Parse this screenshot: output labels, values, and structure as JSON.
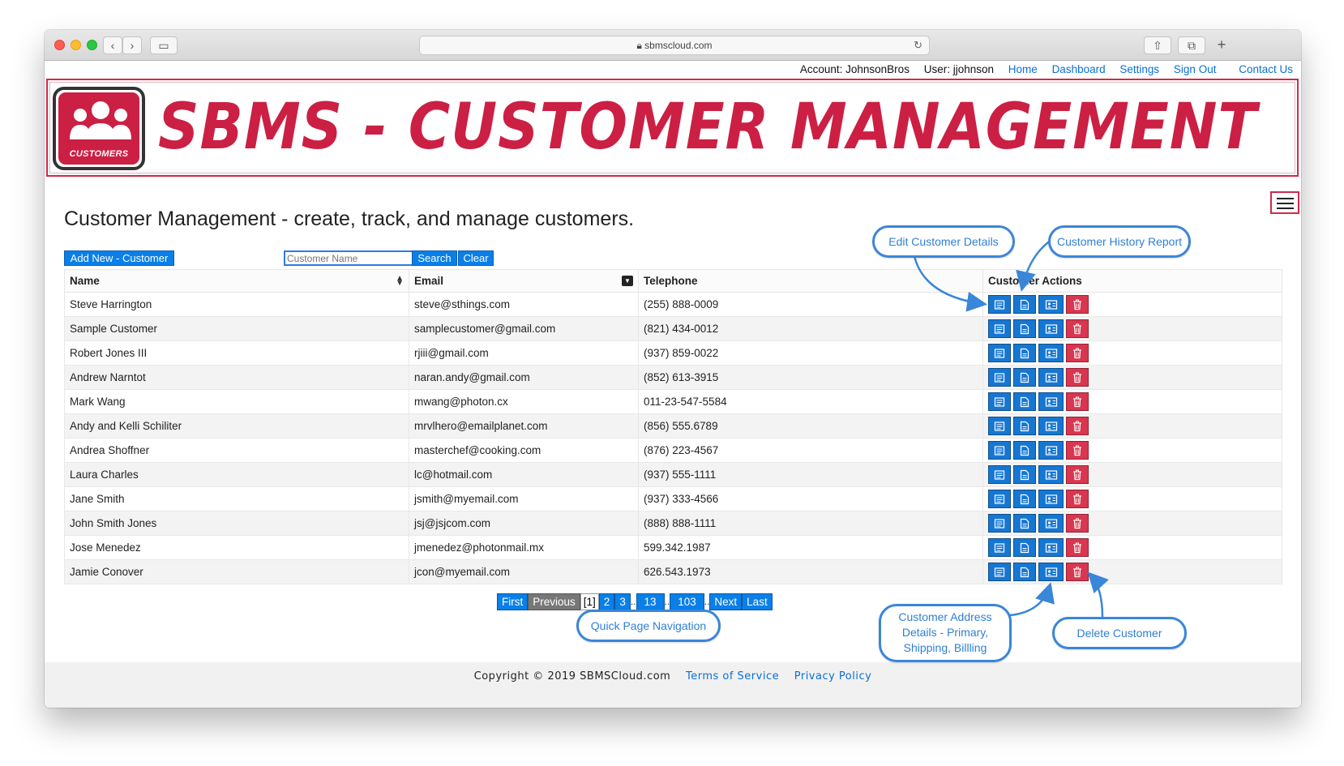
{
  "browser": {
    "url": "sbmscloud.com"
  },
  "topnav": {
    "account": "Account: JohnsonBros",
    "user": "User: jjohnson",
    "links": [
      "Home",
      "Dashboard",
      "Settings",
      "Sign Out",
      "Contact Us"
    ]
  },
  "banner": {
    "logo_text": "CUSTOMERS",
    "title": "SBMS - CUSTOMER MANAGEMENT"
  },
  "heading": "Customer Management - create, track, and manage customers.",
  "toolbar": {
    "add_label": "Add New - Customer",
    "search_placeholder": "Customer Name",
    "search_label": "Search",
    "clear_label": "Clear"
  },
  "table": {
    "headers": [
      "Name",
      "Email",
      "Telephone",
      "Customer Actions"
    ],
    "rows": [
      {
        "name": "Steve Harrington",
        "email": "steve@sthings.com",
        "phone": "(255) 888-0009"
      },
      {
        "name": "Sample Customer",
        "email": "samplecustomer@gmail.com",
        "phone": "(821) 434-0012"
      },
      {
        "name": "Robert Jones III",
        "email": "rjiii@gmail.com",
        "phone": "(937) 859-0022"
      },
      {
        "name": "Andrew Narntot",
        "email": "naran.andy@gmail.com",
        "phone": "(852) 613-3915"
      },
      {
        "name": "Mark Wang",
        "email": "mwang@photon.cx",
        "phone": "011-23-547-5584"
      },
      {
        "name": "Andy and Kelli Schiliter",
        "email": "mrvlhero@emailplanet.com",
        "phone": "(856) 555.6789"
      },
      {
        "name": "Andrea Shoffner",
        "email": "masterchef@cooking.com",
        "phone": "(876) 223-4567"
      },
      {
        "name": "Laura Charles",
        "email": "lc@hotmail.com",
        "phone": "(937) 555-1111"
      },
      {
        "name": "Jane Smith",
        "email": "jsmith@myemail.com",
        "phone": "(937) 333-4566"
      },
      {
        "name": "John Smith Jones",
        "email": "jsj@jsjcom.com",
        "phone": "(888) 888-1111"
      },
      {
        "name": "Jose Menedez",
        "email": "jmenedez@photonmail.mx",
        "phone": "599.342.1987"
      },
      {
        "name": "Jamie Conover",
        "email": "jcon@myemail.com",
        "phone": "626.543.1973"
      }
    ]
  },
  "pagination": {
    "first": "First",
    "previous": "Previous",
    "current": "[1]",
    "pages": [
      "2",
      "3",
      "13",
      "103"
    ],
    "next": "Next",
    "last": "Last"
  },
  "footer": {
    "copyright": "Copyright © 2019 SBMSCloud.com",
    "terms": "Terms of Service",
    "privacy": "Privacy Policy"
  },
  "callouts": {
    "edit": "Edit Customer Details",
    "history": "Customer History Report",
    "quick_nav": "Quick Page Navigation",
    "address": "Customer Address Details - Primary, Shipping, Billling",
    "delete": "Delete Customer"
  },
  "colors": {
    "brand_red": "#cc1f44",
    "action_blue": "#1677d3",
    "delete_red": "#d9364f",
    "link_blue": "#0a6fd6"
  }
}
